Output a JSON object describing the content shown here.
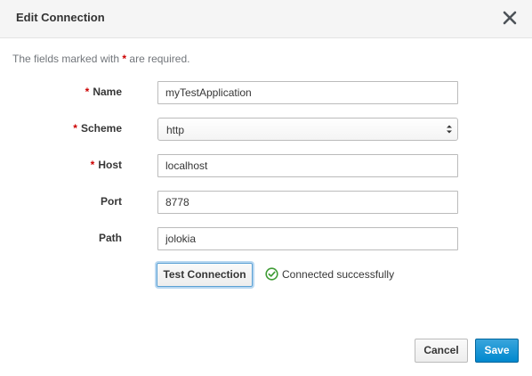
{
  "dialog": {
    "title": "Edit Connection",
    "close_icon": "close-icon"
  },
  "note": {
    "prefix": "The fields marked with",
    "star": "*",
    "suffix": "are required."
  },
  "fields": {
    "name": {
      "label": "Name",
      "required_marker": "*",
      "value": "myTestApplication"
    },
    "scheme": {
      "label": "Scheme",
      "required_marker": "*",
      "value": "http"
    },
    "host": {
      "label": "Host",
      "required_marker": "*",
      "value": "localhost"
    },
    "port": {
      "label": "Port",
      "value": "8778"
    },
    "path": {
      "label": "Path",
      "value": "jolokia"
    }
  },
  "test": {
    "button_label": "Test Connection",
    "status_icon": "check-circle-icon",
    "status_text": "Connected successfully"
  },
  "footer": {
    "cancel_label": "Cancel",
    "save_label": "Save"
  },
  "colors": {
    "required_star": "#cc0000",
    "primary": "#0088ce",
    "success": "#3f9c35"
  }
}
